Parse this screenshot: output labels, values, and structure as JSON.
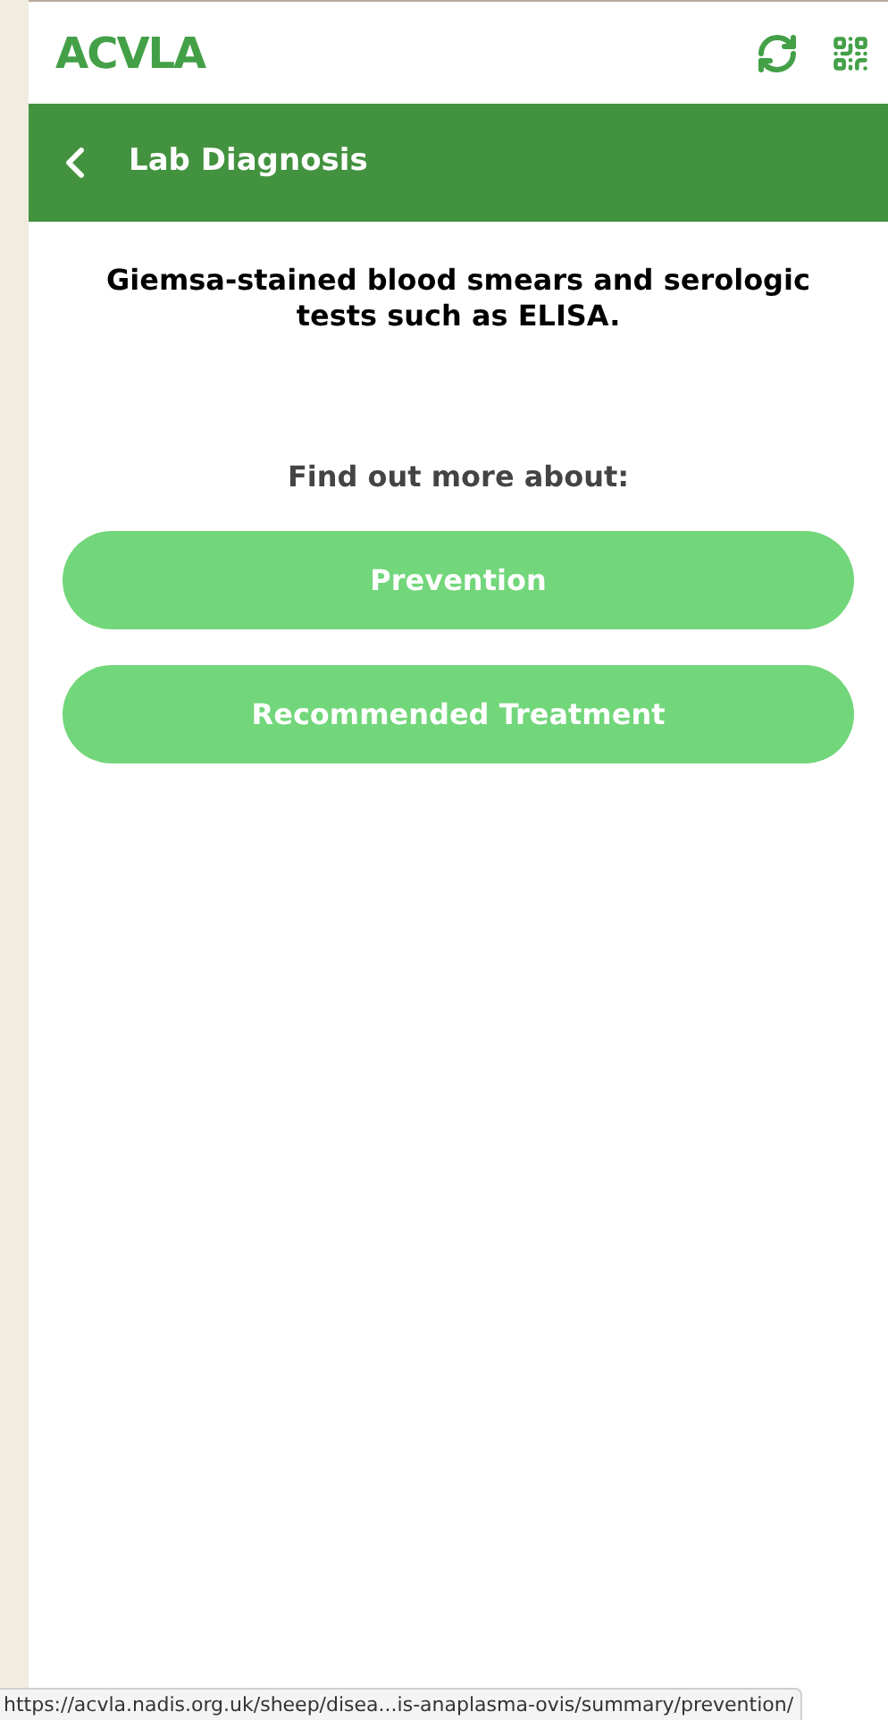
{
  "header": {
    "logo": "ACVLA"
  },
  "title_bar": {
    "title": "Lab Diagnosis"
  },
  "content": {
    "text": "Giemsa-stained blood smears and serologic tests such as ELISA.",
    "prompt": "Find out more about:"
  },
  "links": [
    {
      "label": "Prevention"
    },
    {
      "label": "Recommended Treatment"
    }
  ],
  "status_bar": {
    "url": "https://acvla.nadis.org.uk/sheep/disea...is-anaplasma-ovis/summary/prevention/"
  }
}
